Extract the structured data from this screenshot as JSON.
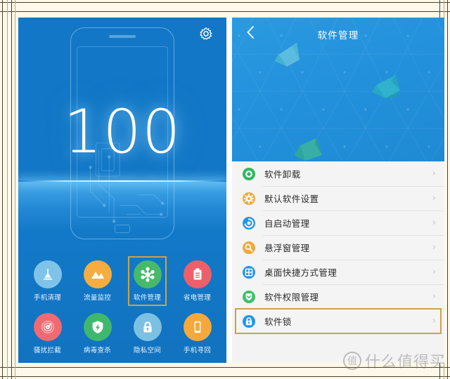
{
  "left_panel": {
    "score": "100",
    "gear_icon": "gear-icon",
    "icons": [
      {
        "label": "手机清理",
        "icon": "broom-icon",
        "circle": "#7fc4e8",
        "glyph": "#ffffff",
        "selected": false
      },
      {
        "label": "流量监控",
        "icon": "chart-icon",
        "circle": "#f5b košt",
        "glyph": "#ffffff",
        "selected": false
      },
      {
        "label": "软件管理",
        "icon": "hexagon-gear-icon",
        "circle": "#46b96a",
        "glyph": "#ffffff",
        "selected": true
      },
      {
        "label": "省电管理",
        "icon": "clipboard-icon",
        "circle": "#ef5f6b",
        "glyph": "#ffffff",
        "selected": false
      },
      {
        "label": "骚扰拦截",
        "icon": "radar-icon",
        "circle": "#ef6a72",
        "glyph": "#ffffff",
        "selected": false
      },
      {
        "label": "病毒查杀",
        "icon": "shield-bolt-icon",
        "circle": "#3fb86e",
        "glyph": "#ffffff",
        "selected": false
      },
      {
        "label": "隐私空间",
        "icon": "lock-icon",
        "circle": "#7cc0e2",
        "glyph": "#ffffff",
        "selected": false
      },
      {
        "label": "手机寻回",
        "icon": "phone-icon",
        "circle": "#f5a93a",
        "glyph": "#ffffff",
        "selected": false
      }
    ]
  },
  "right_panel": {
    "title": "软件管理",
    "back_icon": "chevron-left-icon",
    "chevron": "›",
    "rows": [
      {
        "label": "软件卸载",
        "icon": "uninstall-ring-icon",
        "color": "#2fb95e",
        "selected": false
      },
      {
        "label": "默认软件设置",
        "icon": "gear-icon",
        "color": "#f0a93c",
        "selected": false
      },
      {
        "label": "自启动管理",
        "icon": "refresh-spiral-icon",
        "color": "#2196e8",
        "selected": false
      },
      {
        "label": "悬浮窗管理",
        "icon": "magnifier-icon",
        "color": "#f0a93c",
        "selected": false
      },
      {
        "label": "桌面快捷方式管理",
        "icon": "grid-icon",
        "color": "#2196e8",
        "selected": false
      },
      {
        "label": "软件权限管理",
        "icon": "shield-check-icon",
        "color": "#3fc06a",
        "selected": false
      },
      {
        "label": "软件锁",
        "icon": "lock-icon",
        "color": "#2196e8",
        "selected": true
      }
    ]
  },
  "watermark": {
    "badge": "值",
    "text": "什么值得买"
  },
  "colors": {
    "frame_bg": "#fdf8ea",
    "frame_line": "#4a4228",
    "highlight": "#c9a349",
    "left_blue": "#1277c6",
    "header_blue": "#2391dc"
  }
}
